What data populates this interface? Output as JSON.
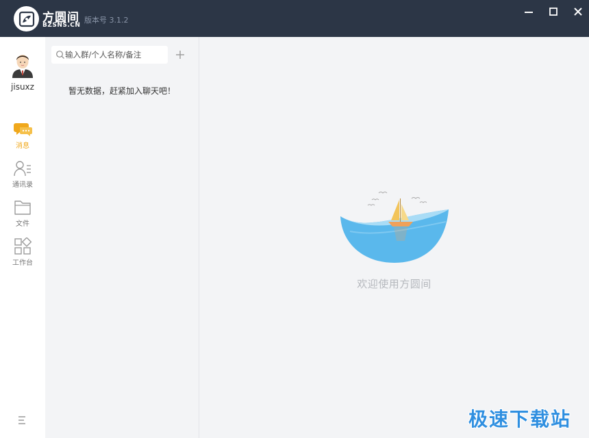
{
  "titlebar": {
    "brand_name": "方圆间",
    "brand_domain": "BZSNS.CN",
    "version": "版本号 3.1.2"
  },
  "user": {
    "name": "jisuxz"
  },
  "nav": {
    "items": [
      {
        "label": "消息",
        "icon": "chat-bubble-icon",
        "active": true
      },
      {
        "label": "通讯录",
        "icon": "contacts-icon",
        "active": false
      },
      {
        "label": "文件",
        "icon": "folder-icon",
        "active": false
      },
      {
        "label": "工作台",
        "icon": "apps-grid-icon",
        "active": false
      }
    ]
  },
  "panel": {
    "search_placeholder": "输入群/个人名称/备注",
    "empty_text": "暂无数据，赶紧加入聊天吧！"
  },
  "main": {
    "welcome": "欢迎使用方圆间"
  },
  "watermark": "极速下载站",
  "colors": {
    "titlebar": "#2c3646",
    "accent": "#f0a81c",
    "background": "#f3f4f6",
    "sea": "#5ab8ec",
    "watermark": "#2f8fe0"
  }
}
